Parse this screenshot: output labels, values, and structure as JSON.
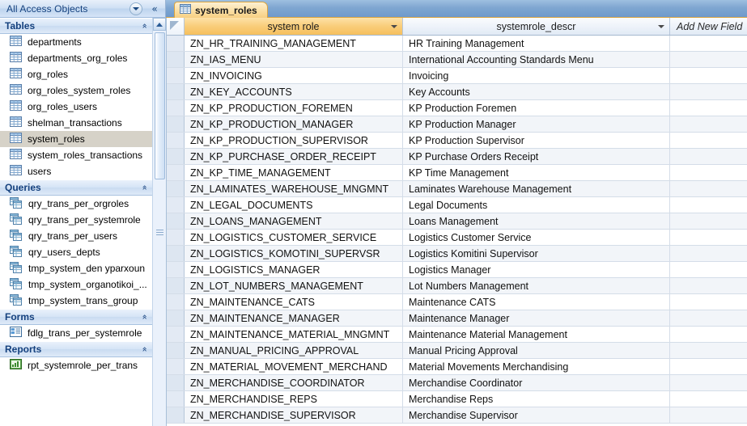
{
  "nav": {
    "title": "All Access Objects",
    "title_dropdown_icon": "chevron-down-circle-icon",
    "collapse_icon": "double-chevron-left-icon",
    "groups": [
      {
        "name": "Tables",
        "collapse_icon": "double-chevron-up-icon",
        "items": [
          {
            "label": "departments",
            "icon": "table-icon",
            "selected": false
          },
          {
            "label": "departments_org_roles",
            "icon": "table-icon",
            "selected": false
          },
          {
            "label": "org_roles",
            "icon": "table-icon",
            "selected": false
          },
          {
            "label": "org_roles_system_roles",
            "icon": "table-icon",
            "selected": false
          },
          {
            "label": "org_roles_users",
            "icon": "table-icon",
            "selected": false
          },
          {
            "label": "shelman_transactions",
            "icon": "table-icon",
            "selected": false
          },
          {
            "label": "system_roles",
            "icon": "table-icon",
            "selected": true
          },
          {
            "label": "system_roles_transactions",
            "icon": "table-icon",
            "selected": false
          },
          {
            "label": "users",
            "icon": "table-icon",
            "selected": false
          }
        ]
      },
      {
        "name": "Queries",
        "collapse_icon": "double-chevron-up-icon",
        "items": [
          {
            "label": "qry_trans_per_orgroles",
            "icon": "query-icon",
            "selected": false
          },
          {
            "label": "qry_trans_per_systemrole",
            "icon": "query-icon",
            "selected": false
          },
          {
            "label": "qry_trans_per_users",
            "icon": "query-icon",
            "selected": false
          },
          {
            "label": "qry_users_depts",
            "icon": "query-icon",
            "selected": false
          },
          {
            "label": "tmp_system_den yparxoun",
            "icon": "query-icon",
            "selected": false
          },
          {
            "label": "tmp_system_organotikoi_...",
            "icon": "query-icon",
            "selected": false
          },
          {
            "label": "tmp_system_trans_group",
            "icon": "query-icon",
            "selected": false
          }
        ]
      },
      {
        "name": "Forms",
        "collapse_icon": "double-chevron-up-icon",
        "items": [
          {
            "label": "fdlg_trans_per_systemrole",
            "icon": "form-icon",
            "selected": false
          }
        ]
      },
      {
        "name": "Reports",
        "collapse_icon": "double-chevron-up-icon",
        "items": [
          {
            "label": "rpt_systemrole_per_trans",
            "icon": "report-icon",
            "selected": false
          }
        ]
      }
    ]
  },
  "document": {
    "tab_label": "system_roles",
    "tab_icon": "table-icon"
  },
  "datasheet": {
    "columns": [
      {
        "label": "system role",
        "active": true,
        "dropdown_icon": "chevron-down-icon"
      },
      {
        "label": "systemrole_descr",
        "active": false,
        "dropdown_icon": "chevron-down-icon"
      },
      {
        "label": "Add New Field",
        "active": false,
        "dropdown_icon": ""
      }
    ],
    "rows": [
      {
        "system_role": "ZN_HR_TRAINING_MANAGEMENT",
        "systemrole_descr": "HR Training Management"
      },
      {
        "system_role": "ZN_IAS_MENU",
        "systemrole_descr": "International Accounting Standards Menu"
      },
      {
        "system_role": "ZN_INVOICING",
        "systemrole_descr": "Invoicing"
      },
      {
        "system_role": "ZN_KEY_ACCOUNTS",
        "systemrole_descr": "Key Accounts"
      },
      {
        "system_role": "ZN_KP_PRODUCTION_FOREMEN",
        "systemrole_descr": "KP Production Foremen"
      },
      {
        "system_role": "ZN_KP_PRODUCTION_MANAGER",
        "systemrole_descr": "KP Production Manager"
      },
      {
        "system_role": "ZN_KP_PRODUCTION_SUPERVISOR",
        "systemrole_descr": "KP Production Supervisor"
      },
      {
        "system_role": "ZN_KP_PURCHASE_ORDER_RECEIPT",
        "systemrole_descr": "KP Purchase Orders Receipt"
      },
      {
        "system_role": "ZN_KP_TIME_MANAGEMENT",
        "systemrole_descr": "KP Time Management"
      },
      {
        "system_role": "ZN_LAMINATES_WAREHOUSE_MNGMNT",
        "systemrole_descr": "Laminates Warehouse Management"
      },
      {
        "system_role": "ZN_LEGAL_DOCUMENTS",
        "systemrole_descr": "Legal Documents"
      },
      {
        "system_role": "ZN_LOANS_MANAGEMENT",
        "systemrole_descr": "Loans Management"
      },
      {
        "system_role": "ZN_LOGISTICS_CUSTOMER_SERVICE",
        "systemrole_descr": "Logistics Customer Service"
      },
      {
        "system_role": "ZN_LOGISTICS_KOMOTINI_SUPERVSR",
        "systemrole_descr": "Logistics Komitini Supervisor"
      },
      {
        "system_role": "ZN_LOGISTICS_MANAGER",
        "systemrole_descr": "Logistics Manager"
      },
      {
        "system_role": "ZN_LOT_NUMBERS_MANAGEMENT",
        "systemrole_descr": "Lot Numbers Management"
      },
      {
        "system_role": "ZN_MAINTENANCE_CATS",
        "systemrole_descr": "Maintenance CATS"
      },
      {
        "system_role": "ZN_MAINTENANCE_MANAGER",
        "systemrole_descr": "Maintenance Manager"
      },
      {
        "system_role": "ZN_MAINTENANCE_MATERIAL_MNGMNT",
        "systemrole_descr": "Maintenance Material Management"
      },
      {
        "system_role": "ZN_MANUAL_PRICING_APPROVAL",
        "systemrole_descr": "Manual Pricing Approval"
      },
      {
        "system_role": "ZN_MATERIAL_MOVEMENT_MERCHAND",
        "systemrole_descr": "Material Movements Merchandising"
      },
      {
        "system_role": "ZN_MERCHANDISE_COORDINATOR",
        "systemrole_descr": "Merchandise Coordinator"
      },
      {
        "system_role": "ZN_MERCHANDISE_REPS",
        "systemrole_descr": "Merchandise Reps"
      },
      {
        "system_role": "ZN_MERCHANDISE_SUPERVISOR",
        "systemrole_descr": "Merchandise Supervisor"
      }
    ]
  },
  "colors": {
    "accent_orange": "#f6c05d",
    "nav_header_blue": "#15417e",
    "selection_gray": "#d6d2c8",
    "alt_row": "#f2f5f9",
    "chrome_blue": "#7ba3d0"
  }
}
